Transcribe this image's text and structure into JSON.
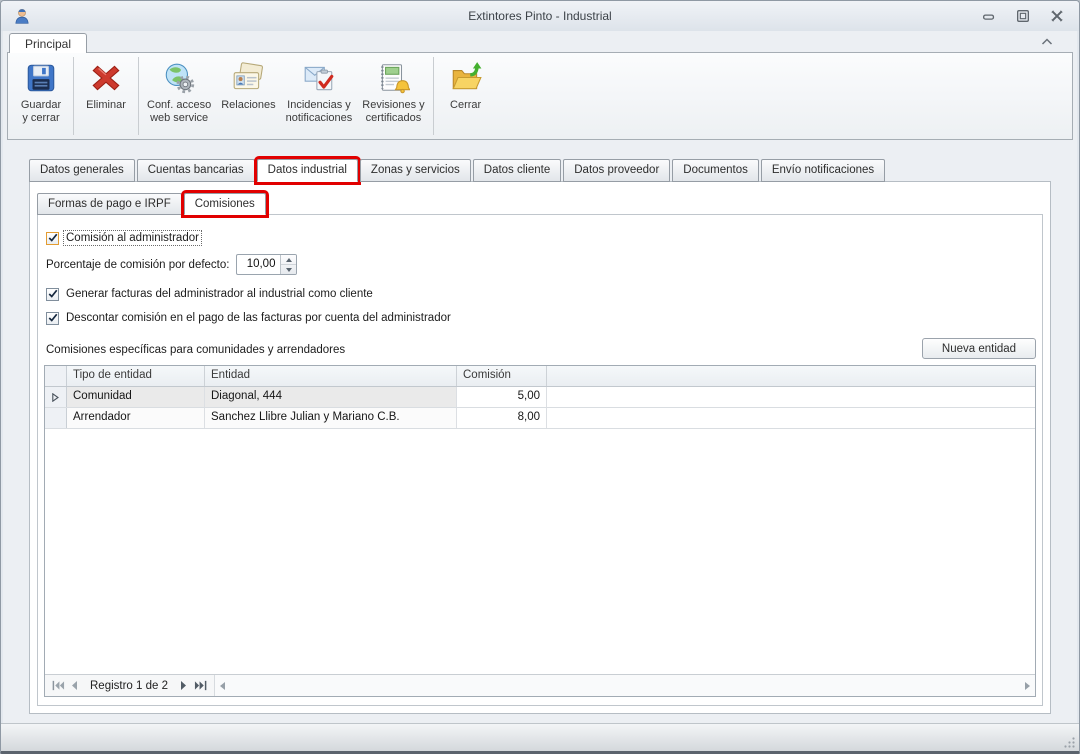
{
  "titlebar": {
    "title": "Extintores Pinto - Industrial"
  },
  "ribbon": {
    "tab_label": "Principal",
    "buttons": [
      {
        "label": "Guardar\ny cerrar",
        "icon": "save-close-icon"
      },
      {
        "label": "Eliminar",
        "icon": "delete-icon"
      },
      {
        "label": "Conf. acceso\nweb service",
        "icon": "web-service-config-icon"
      },
      {
        "label": "Relaciones",
        "icon": "relations-icon"
      },
      {
        "label": "Incidencias y\nnotificaciones",
        "icon": "incidents-notifications-icon"
      },
      {
        "label": "Revisiones y\ncertificados",
        "icon": "revisions-certificates-icon"
      },
      {
        "label": "Cerrar",
        "icon": "close-folder-icon"
      }
    ]
  },
  "tabs": [
    "Datos generales",
    "Cuentas bancarias",
    "Datos industrial",
    "Zonas y servicios",
    "Datos cliente",
    "Datos proveedor",
    "Documentos",
    "Envío notificaciones"
  ],
  "selected_tab": "Datos industrial",
  "subtabs": [
    "Formas de pago e IRPF",
    "Comisiones"
  ],
  "selected_subtab": "Comisiones",
  "form": {
    "admin_commission_checkbox": "Comisión al administrador",
    "admin_commission_checked": true,
    "default_percent_label": "Porcentaje de comisión por defecto:",
    "default_percent_value": "10,00",
    "generate_invoices_checkbox": "Generar facturas del administrador al industrial como cliente",
    "generate_invoices_checked": true,
    "discount_commission_checkbox": "Descontar comisión en el pago de las facturas por cuenta del administrador",
    "discount_commission_checked": true,
    "grid_caption": "Comisiones específicas para comunidades y arrendadores",
    "new_entity_button": "Nueva entidad"
  },
  "grid": {
    "columns": [
      "Tipo de entidad",
      "Entidad",
      "Comisión"
    ],
    "rows": [
      {
        "tipo": "Comunidad",
        "entidad": "Diagonal, 444",
        "comision": "5,00"
      },
      {
        "tipo": "Arrendador",
        "entidad": "Sanchez Llibre Julian y Mariano C.B.",
        "comision": "8,00"
      }
    ],
    "navigator_label": "Registro 1 de 2"
  },
  "annotations": {
    "highlight_color": "#e10000",
    "highlighted_tab": "Datos industrial",
    "highlighted_subtab": "Comisiones"
  },
  "colors": {
    "focus_checkbox_border": "#e39c31",
    "titlebar_gradient_top": "#f0f3f7",
    "grid_header_bg": "#eef2f6"
  },
  "icons": {
    "titlebar": "user-icon",
    "window_controls": [
      "minimize-icon",
      "maximize-icon",
      "close-icon"
    ],
    "ribbon_collapse": "chevron-up-icon",
    "navigator": [
      "first-record-icon",
      "prev-record-icon",
      "next-record-icon",
      "last-record-icon"
    ]
  }
}
